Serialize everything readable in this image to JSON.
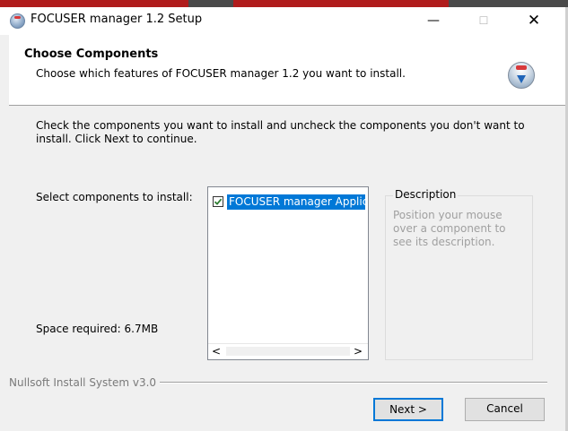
{
  "window": {
    "title": "FOCUSER manager 1.2 Setup",
    "min_glyph": "—",
    "max_glyph": "☐",
    "close_glyph": "✕"
  },
  "header": {
    "title": "Choose Components",
    "subtitle": "Choose which features of FOCUSER manager 1.2 you want to install.",
    "icon": "installer-globe-icon"
  },
  "body": {
    "instructions": "Check the components you want to install and uncheck the components you don't want to install. Click Next to continue.",
    "select_label": "Select components to install:",
    "space_required": "Space required: 6.7MB"
  },
  "components": {
    "items": [
      {
        "label": "FOCUSER manager Application",
        "checked": true,
        "selected": true
      }
    ],
    "scroll_left": "<",
    "scroll_right": ">"
  },
  "description": {
    "legend": "Description",
    "text": "Position your mouse over a component to see its description."
  },
  "footer": {
    "branding": "Nullsoft Install System v3.0",
    "next_label": "Next >",
    "cancel_label": "Cancel"
  },
  "colors": {
    "selection": "#0078d7",
    "check": "#2e7d32"
  }
}
